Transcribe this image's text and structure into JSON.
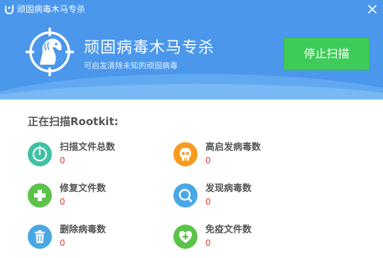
{
  "window": {
    "title": "顽固病毒木马专杀"
  },
  "hero": {
    "title": "顽固病毒木马专杀",
    "subtitle": "可启发清除未知的顽固病毒",
    "stop_button_label": "停止扫描"
  },
  "scan": {
    "status_text": "正在扫描Rootkit:"
  },
  "stats": {
    "scanned_files": {
      "label": "扫描文件总数",
      "value": "0",
      "icon": "timer-icon",
      "color": "#3ec1a4"
    },
    "high_risk": {
      "label": "高启发病毒数",
      "value": "0",
      "icon": "skull-icon",
      "color": "#f79b1e"
    },
    "repaired_files": {
      "label": "修复文件数",
      "value": "0",
      "icon": "plus-icon",
      "color": "#5cc349"
    },
    "found_viruses": {
      "label": "发现病毒数",
      "value": "0",
      "icon": "search-icon",
      "color": "#4aa7e6"
    },
    "deleted_viruses": {
      "label": "删除病毒数",
      "value": "0",
      "icon": "trash-icon",
      "color": "#4aa7e6"
    },
    "immune_files": {
      "label": "免疫文件数",
      "value": "0",
      "icon": "heart-shield-icon",
      "color": "#5cc349"
    }
  },
  "colors": {
    "header_blue": "#4a97ec",
    "stop_button_green": "#3fcb58",
    "value_red": "#e53935"
  }
}
